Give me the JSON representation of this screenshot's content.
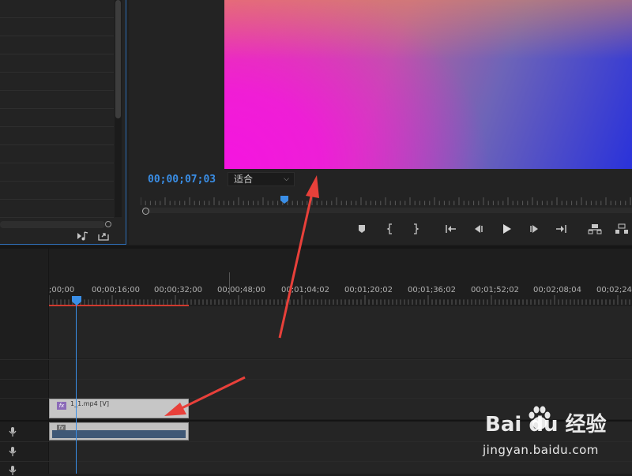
{
  "monitor": {
    "timecode": "00;00;07;03",
    "zoom_value": "适合"
  },
  "timeline": {
    "ruler_labels": [
      ";00;00",
      "00;00;16;00",
      "00;00;32;00",
      "00;00;48;00",
      "00;01;04;02",
      "00;01;20;02",
      "00;01;36;02",
      "00;01;52;02",
      "00;02;08;04",
      "00;02;24;"
    ],
    "video_clip_label": "1_1.mp4 [V]",
    "fx_badge": "fx"
  },
  "watermark": {
    "logo_text": "Bai  du 经验",
    "url": "jingyan.baidu.com"
  },
  "colors": {
    "accent_blue": "#3a8ee6",
    "work_area_red": "#d03a2e",
    "annotation_arrow": "#e8403a"
  },
  "icons": [
    "marker-icon",
    "mark-in-icon",
    "mark-out-icon",
    "go-to-in-icon",
    "step-back-icon",
    "play-icon",
    "step-forward-icon",
    "go-to-out-icon",
    "lift-icon",
    "extract-icon",
    "microphone-icon",
    "paw-icon"
  ]
}
